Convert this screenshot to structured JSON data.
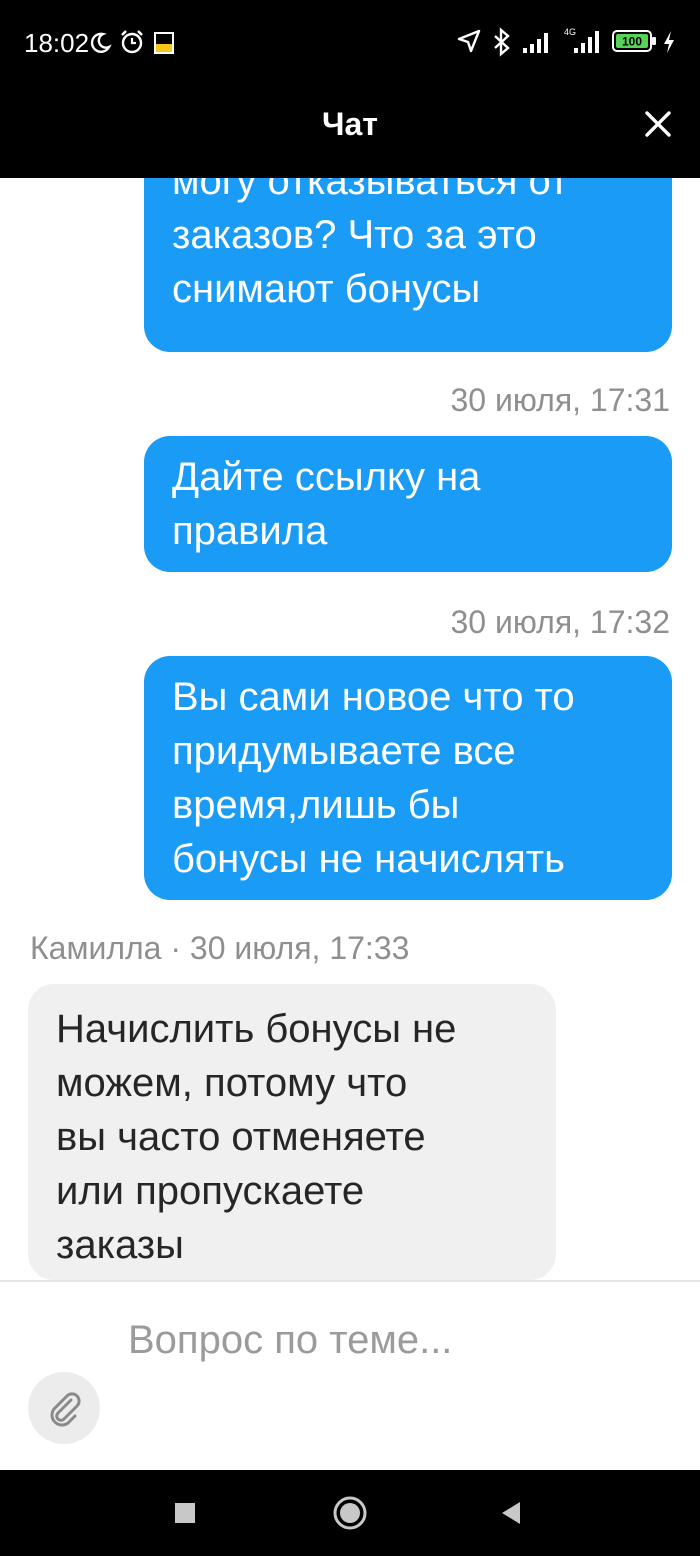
{
  "status_bar": {
    "time": "18:02",
    "battery": "100",
    "network": "4G",
    "icons": [
      "moon-icon",
      "alarm-icon",
      "notification-icon",
      "location-icon",
      "bluetooth-icon",
      "signal-icon",
      "signal-4g-icon",
      "battery-icon",
      "charging-icon"
    ]
  },
  "header": {
    "title": "Чат",
    "close_icon": "close-icon"
  },
  "messages": [
    {
      "direction": "outgoing",
      "lines": [
        "могу отказываться от",
        "заказов? Что за это",
        "снимают бонусы"
      ]
    },
    {
      "direction": "outgoing",
      "meta": "30 июля, 17:31",
      "lines": [
        "Дайте ссылку на",
        "правила"
      ]
    },
    {
      "direction": "outgoing",
      "meta": "30 июля, 17:32",
      "lines": [
        "Вы сами новое что то",
        "придумываете все",
        "время,лишь бы",
        "бонусы не начислять"
      ]
    },
    {
      "direction": "incoming",
      "meta": "Камилла · 30 июля, 17:33",
      "lines": [
        "Начислить бонусы не",
        "можем, потому что",
        "вы часто отменяете",
        "или пропускаете",
        "заказы"
      ]
    }
  ],
  "composer": {
    "placeholder": "Вопрос по теме...",
    "value": "",
    "attach_icon": "paperclip-icon"
  },
  "nav_bar": {
    "icons": [
      "recent-apps-icon",
      "home-icon",
      "back-icon"
    ]
  },
  "colors": {
    "outgoing_bubble": "#1a9bf5",
    "incoming_bubble": "#f0f0f0",
    "meta_text": "#8f8f8f",
    "bar_background": "#000000"
  }
}
